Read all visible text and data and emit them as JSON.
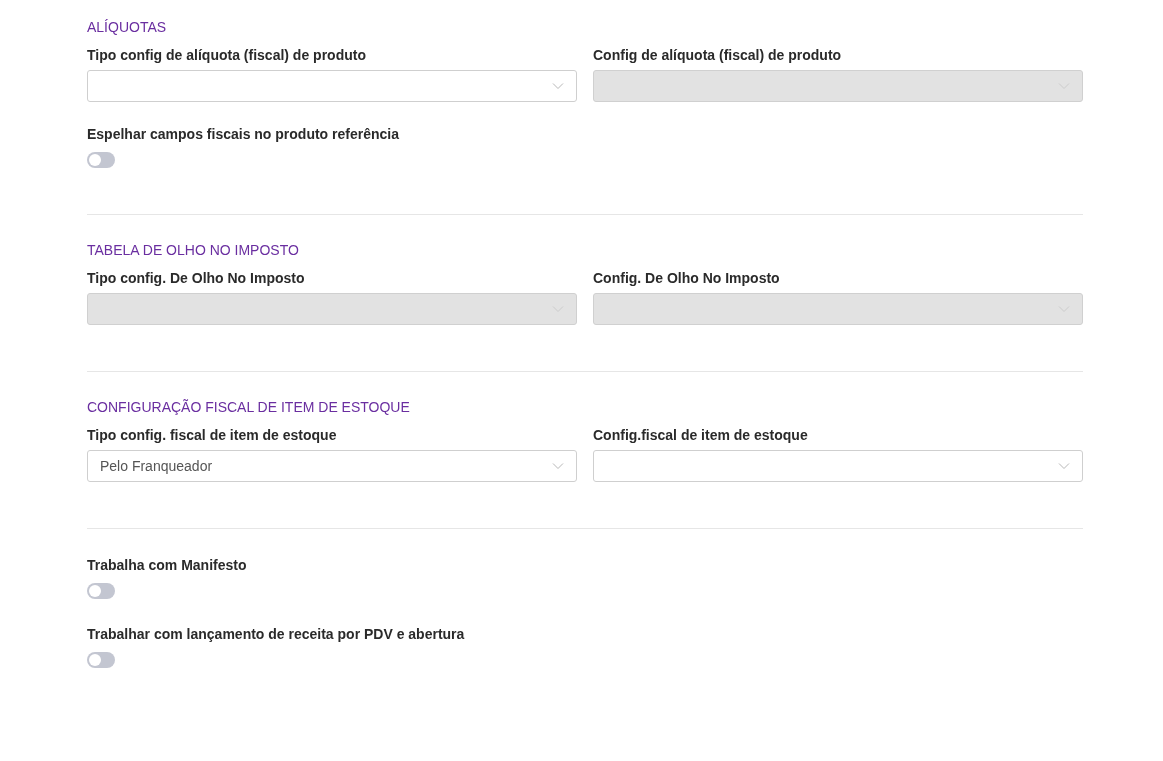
{
  "sections": [
    {
      "title": "ALÍQUOTAS",
      "fields": [
        {
          "label": "Tipo config de alíquota (fiscal) de produto",
          "disabled": false
        },
        {
          "label": "Config de alíquota (fiscal) de produto",
          "disabled": true
        }
      ],
      "toggles": [
        {
          "label": "Espelhar campos fiscais no produto referência",
          "on": false
        }
      ]
    },
    {
      "title": "TABELA DE OLHO NO IMPOSTO",
      "fields": [
        {
          "label": "Tipo config. De Olho No Imposto",
          "disabled": true
        },
        {
          "label": "Config. De Olho No Imposto",
          "disabled": true
        }
      ]
    },
    {
      "title": "CONFIGURAÇÃO FISCAL DE ITEM DE ESTOQUE",
      "fields": [
        {
          "label": "Tipo config. fiscal de item de estoque",
          "value": "Pelo Franqueador",
          "disabled": false
        },
        {
          "label": "Config.fiscal de item de estoque",
          "disabled": false
        }
      ]
    },
    {
      "toggles": [
        {
          "label": "Trabalha com Manifesto",
          "on": false
        },
        {
          "label": "Trabalhar com lançamento de receita por PDV e abertura",
          "on": false
        }
      ]
    }
  ]
}
